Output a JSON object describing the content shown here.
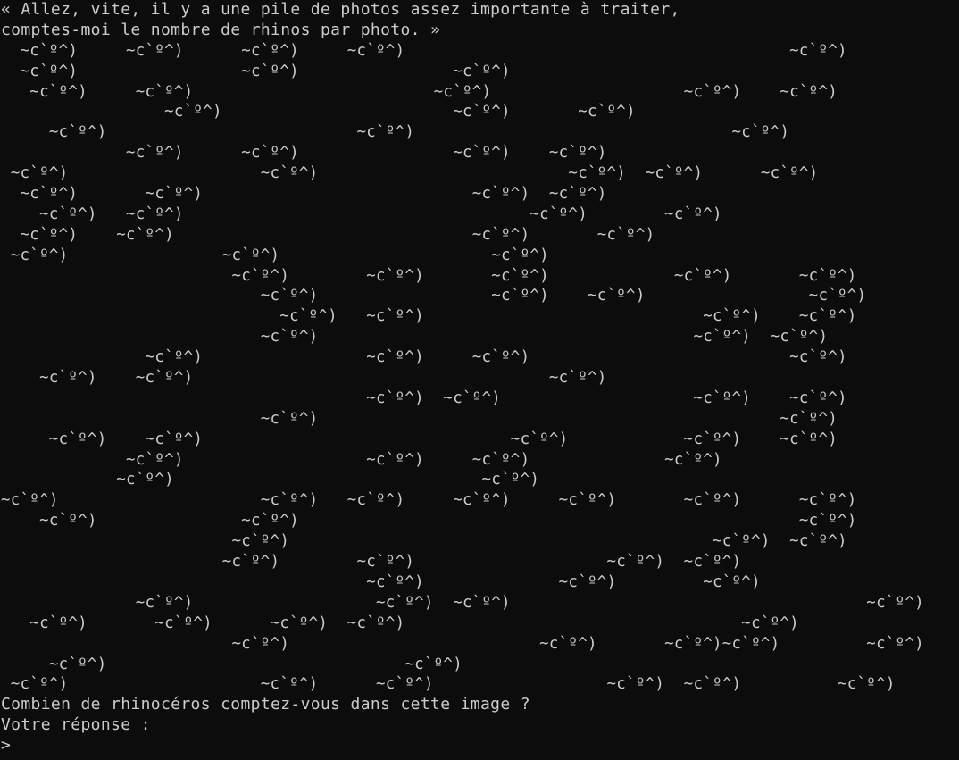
{
  "terminal": {
    "background": "#0c0c0c",
    "foreground": "#cccccc",
    "intro": [
      "« Allez, vite, il y a une pile de photos assez importante à traiter,",
      "comptes-moi le nombre de rhinos par photo. »"
    ],
    "rhino_glyph": "~c'º^)",
    "rows": [
      "  ~c`º^)     ~c`º^)      ~c`º^)     ~c`º^)                                        ~c`º^)",
      "  ~c`º^)                 ~c`º^)                ~c`º^)",
      "   ~c`º^)     ~c`º^)                         ~c`º^)                    ~c`º^)    ~c`º^)",
      "                 ~c`º^)                        ~c`º^)       ~c`º^)",
      "     ~c`º^)                          ~c`º^)                                 ~c`º^)",
      "             ~c`º^)      ~c`º^)                ~c`º^)    ~c`º^)",
      " ~c`º^)                    ~c`º^)                          ~c`º^)  ~c`º^)      ~c`º^)",
      "  ~c`º^)       ~c`º^)                            ~c`º^)  ~c`º^)",
      "    ~c`º^)   ~c`º^)                                    ~c`º^)        ~c`º^)",
      "  ~c`º^)    ~c`º^)                               ~c`º^)       ~c`º^)",
      " ~c`º^)                ~c`º^)                      ~c`º^)",
      "                        ~c`º^)        ~c`º^)       ~c`º^)             ~c`º^)       ~c`º^)",
      "                           ~c`º^)                  ~c`º^)    ~c`º^)                 ~c`º^)",
      "                             ~c`º^)   ~c`º^)                             ~c`º^)    ~c`º^)",
      "                           ~c`º^)                                       ~c`º^)  ~c`º^)",
      "               ~c`º^)                 ~c`º^)     ~c`º^)                           ~c`º^)",
      "    ~c`º^)    ~c`º^)                                     ~c`º^)",
      "                                      ~c`º^)  ~c`º^)                    ~c`º^)    ~c`º^)",
      "                           ~c`º^)                                                ~c`º^)",
      "     ~c`º^)    ~c`º^)                                ~c`º^)            ~c`º^)    ~c`º^)",
      "             ~c`º^)                   ~c`º^)     ~c`º^)              ~c`º^)",
      "            ~c`º^)                                ~c`º^)",
      "~c`º^)                     ~c`º^)   ~c`º^)     ~c`º^)     ~c`º^)       ~c`º^)      ~c`º^)",
      "    ~c`º^)               ~c`º^)                                                    ~c`º^)",
      "                        ~c`º^)                                            ~c`º^)  ~c`º^)",
      "                       ~c`º^)        ~c`º^)                    ~c`º^)  ~c`º^)",
      "                                      ~c`º^)              ~c`º^)         ~c`º^)",
      "              ~c`º^)                   ~c`º^)  ~c`º^)                                     ~c`º^)",
      "   ~c`º^)       ~c`º^)      ~c`º^)  ~c`º^)                                   ~c`º^)",
      "                        ~c`º^)                          ~c`º^)       ~c`º^)~c`º^)         ~c`º^)",
      "     ~c`º^)                               ~c`º^)",
      " ~c`º^)                    ~c`º^)      ~c`º^)                  ~c`º^)  ~c`º^)          ~c`º^)"
    ],
    "question": "Combien de rhinocéros comptez-vous dans cette image ?",
    "answer_label": "Votre réponse :",
    "prompt": ">"
  }
}
